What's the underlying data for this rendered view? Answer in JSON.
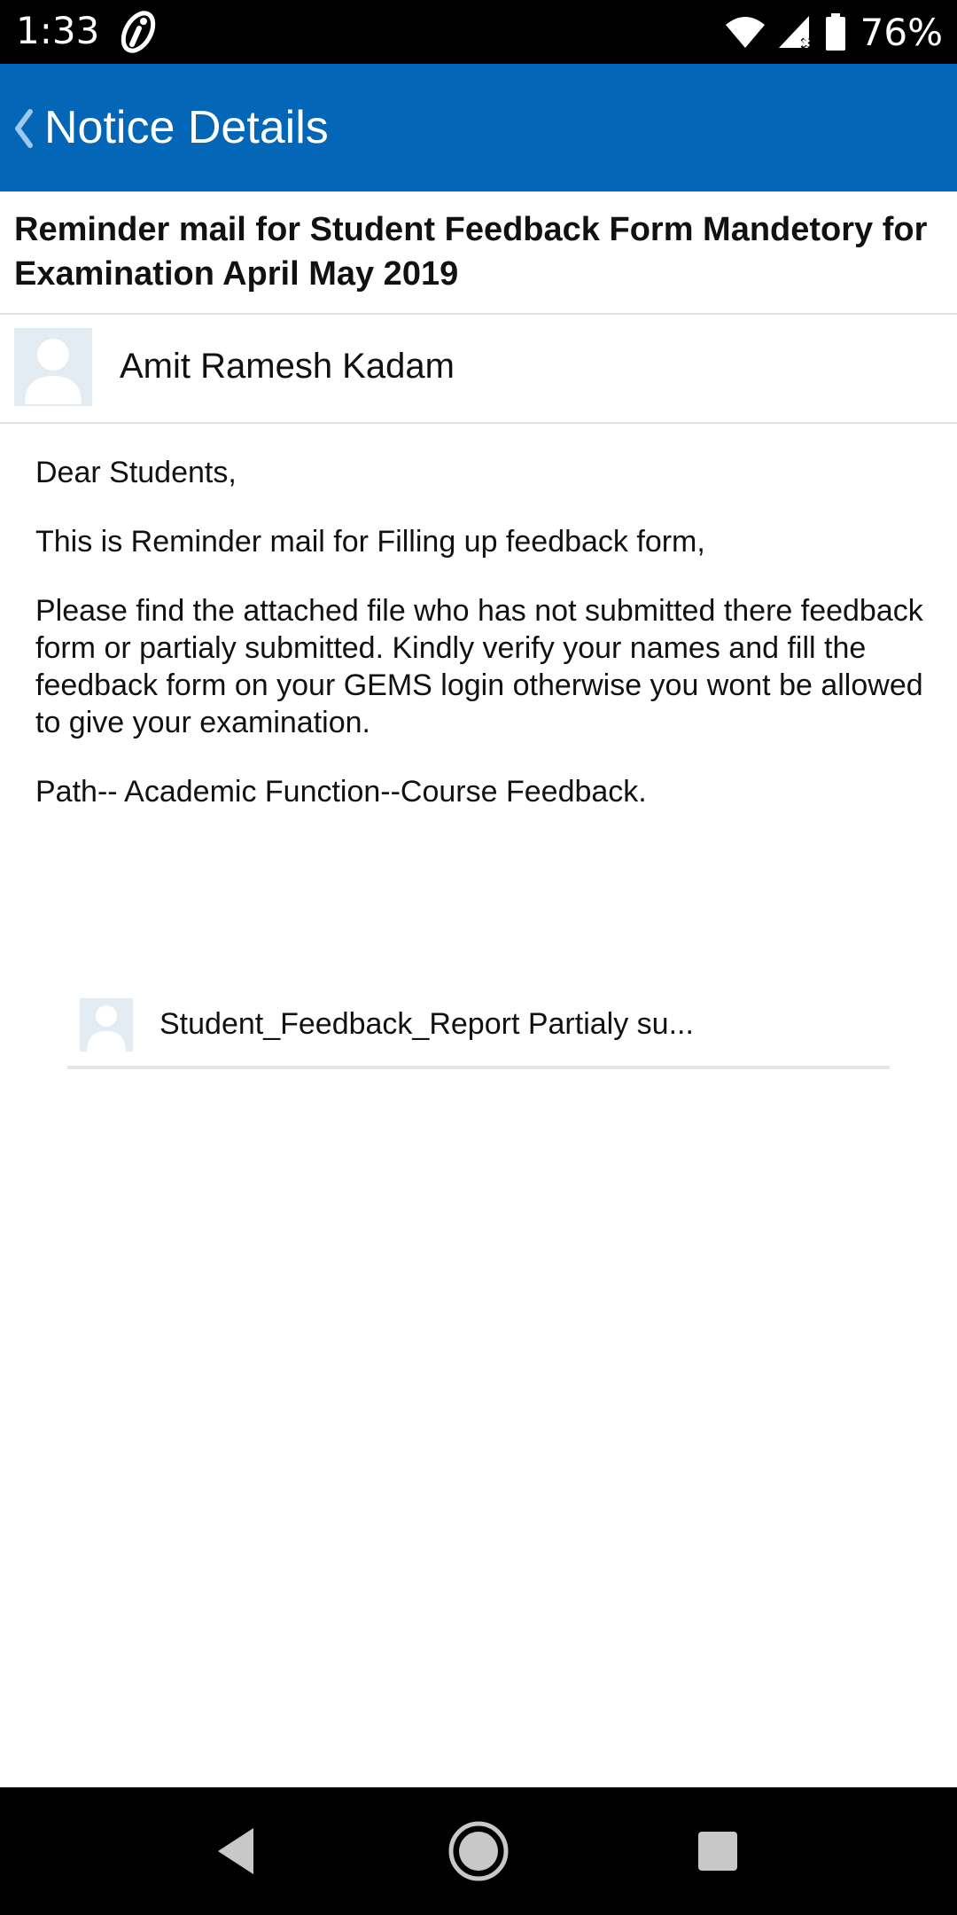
{
  "status_bar": {
    "time": "1:33",
    "battery": "76%",
    "icons": [
      "app-notification-icon",
      "wifi-icon",
      "cell-signal-icon",
      "battery-icon"
    ]
  },
  "app_bar": {
    "title": "Notice Details",
    "back_icon": "chevron-left-icon",
    "color": "#0466b6"
  },
  "notice": {
    "title": "Reminder mail for Student Feedback Form Mandetory for Examination April May 2019",
    "author": "Amit Ramesh Kadam",
    "body": [
      "Dear Students,",
      "This is Reminder mail for Filling up feedback form,",
      "Please find the attached file who has not submitted there feedback form or partialy submitted. Kindly verify your names and fill the feedback form on your GEMS login otherwise you wont be allowed to give your examination.",
      "Path-- Academic Function--Course Feedback."
    ],
    "attachment": {
      "name": "Student_Feedback_Report Partialy su..."
    }
  },
  "nav_bar": {
    "icons": [
      "back-triangle-icon",
      "home-circle-icon",
      "recents-square-icon"
    ]
  }
}
